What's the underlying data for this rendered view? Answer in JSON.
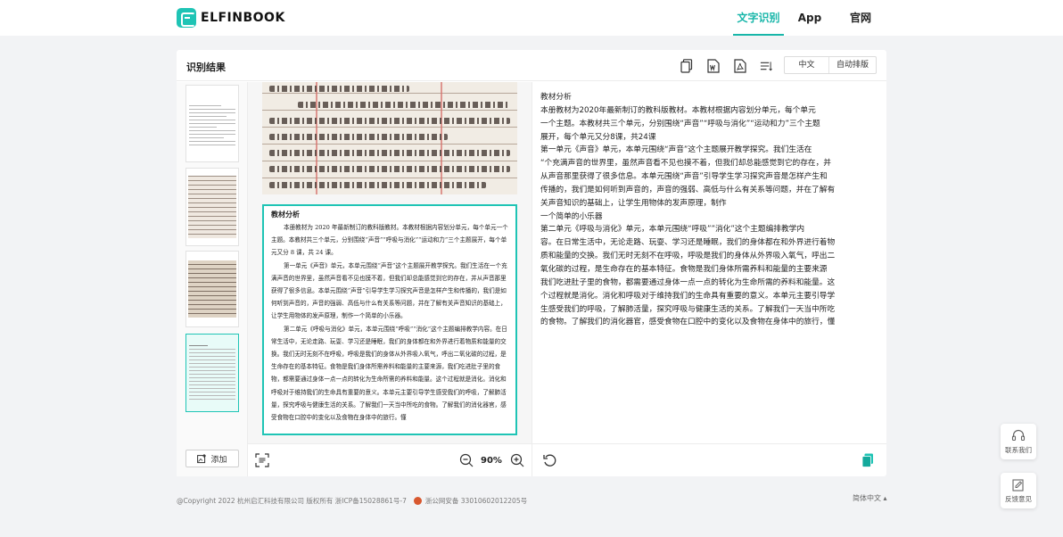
{
  "brand": {
    "name": "ELFINBOOK",
    "accent": "#1fc4b5"
  },
  "nav": {
    "items": [
      "文字识别",
      "App",
      "官网"
    ],
    "active": "文字识别"
  },
  "card": {
    "title": "识别结果",
    "tools": [
      "copy-icon",
      "word-icon",
      "pdf-icon",
      "format-icon"
    ],
    "language": "中文",
    "layout": "自动排版"
  },
  "thumbnails": {
    "count": 4,
    "active_index": 3,
    "add_label": "添加"
  },
  "preview": {
    "zoom": "90%",
    "doc_heading": "教材分析",
    "doc_paragraphs": [
      "本册教材为 2020 年最新制订的教科版教材。本教材根据内容划分单元，每个单元一个主题。本教材共三个单元，分别围绕“声音”“呼吸与消化”“运动和力”三个主题展开，每个单元又分 8 课，共 24 课。",
      "第一单元《声音》单元，本单元围绕“声音”这个主题展开教学探究。我们生活在一个充满声音的世界里，虽然声音看不见也摸不着，但我们却总能感觉到它的存在，并从声音那里获得了很多信息。本单元围绕“声音”引导学生学习探究声音是怎样产生和传播的，我们是如何听到声音的，声音的强弱、高低与什么有关系等问题，并在了解有关声音知识的基础上，让学生用物体的发声原理，制作一个简单的小乐器。",
      "第二单元《呼吸与消化》单元，本单元围绕“呼吸”“消化”这个主题编排教学内容。在日常生活中，无论走路、玩耍、学习还是睡眠，我们的身体都在和外界进行着物质和能量的交换。我们无时无刻不在呼吸，呼吸是我们的身体从外界吸入氧气，呼出二氧化碳的过程，是生命存在的基本特征。食物是我们身体所需养料和能量的主要来源，我们吃进肚子里的食物，都需要通过身体一点一点的转化为生命所需的养料和能量。这个过程就是消化。消化和呼吸对于维持我们的生命具有重要的意义。本单元主要引导学生感受我们的呼吸，了解肺活量，探究呼吸与健康生活的关系。了解我们一天当中所吃的食物。了解我们的消化器官，感受食物在口腔中的变化以及食物在身体中的旅行。懂"
    ]
  },
  "result_lines": [
    "教材分析",
    "本册教材为2020年最新制订的教科版教材。本教材根据内容划分单元，每个单元",
    "一个主题。本教材共三个单元，分别围绕“声音”“呼吸与消化”“运动和力”三个主题",
    "展开，每个单元又分8课，共24课",
    "第一单元《声音》单元，本单元围绕“声音”这个主题展开教学探究。我们生活在",
    "“个充满声音的世界里，虽然声音看不见也摸不着，但我们却总能感觉到它的存在，并",
    "从声音那里获得了很多信息。本单元围绕“声音”引导学生学习探究声音是怎样产生和",
    "传播的，我们是如何听到声音的，声音的强弱、高低与什么有关系等问题，并在了解有",
    "关声音知识的基础上，让学生用物体的发声原理，制作",
    "一个简单的小乐器",
    "第二单元《呼吸与消化》单元，本单元围绕“呼吸””消化”这个主题编排教学内",
    "容。在日常生活中，无论走路、玩耍、学习还是睡眠，我们的身体都在和外界进行着物",
    "质和能量的交换。我们无时无刻不在呼吸，呼吸是我们的身体从外界吸入氧气，呼出二",
    "氧化碳的过程，是生命存在的基本特征。食物是我们身体所需养料和能量的主要来源",
    "我们吃进肚子里的食物，都需要通过身体一点一点的转化为生命所需的养料和能量。这",
    "个过程就是消化。消化和呼吸对于维持我们的生命具有重要的意义。本单元主要引导学",
    "生感受我们的呼吸，了解肺活量，探究呼吸与健康生活的关系。了解我们一天当中所吃",
    "的食物。了解我们的消化器官，感受食物在口腔中的变化以及食物在身体中的旅行，懂"
  ],
  "side": {
    "contact": "联系我们",
    "feedback": "反馈意见"
  },
  "footer": {
    "copyright": "@Copyright 2022 杭州启汇科技有限公司 版权所有 浙ICP备15028861号-7",
    "police": "浙公网安备 33010602012205号",
    "language": "简体中文 ▴"
  }
}
